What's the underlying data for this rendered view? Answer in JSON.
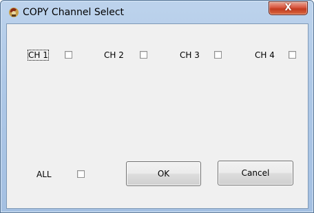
{
  "window": {
    "title": "COPY Channel Select",
    "close_label": "X"
  },
  "channels": [
    {
      "label": "CH 1",
      "checked": false,
      "focused": true
    },
    {
      "label": "CH 2",
      "checked": false,
      "focused": false
    },
    {
      "label": "CH 3",
      "checked": false,
      "focused": false
    },
    {
      "label": "CH 4",
      "checked": false,
      "focused": false
    }
  ],
  "all": {
    "label": "ALL",
    "checked": false
  },
  "buttons": {
    "ok_label": "OK",
    "cancel_label": "Cancel"
  },
  "icons": {
    "app": "copy-app-icon",
    "close": "close-icon"
  },
  "colors": {
    "titlebar": "#b3cbe8",
    "client": "#f0f0f0",
    "close_button": "#c9472d"
  }
}
